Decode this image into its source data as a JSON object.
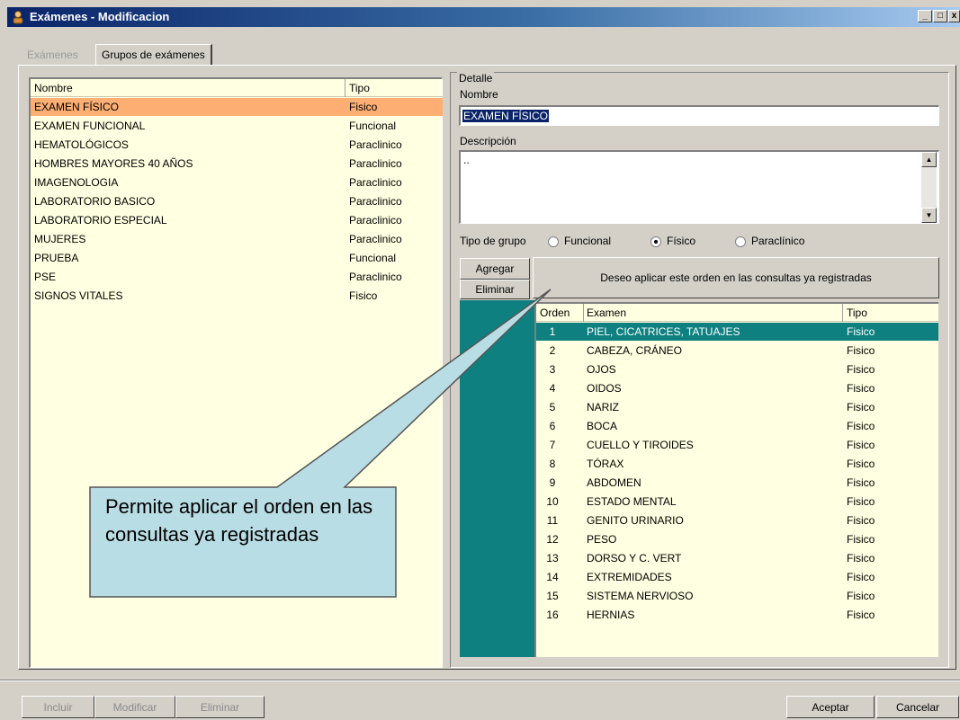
{
  "window": {
    "title": "Exámenes - Modificacion",
    "app_icon": "user-icon",
    "controls": [
      "_",
      "□",
      "x"
    ]
  },
  "tabs": [
    {
      "label": "Exámenes",
      "active": false
    },
    {
      "label": "Grupos de exámenes",
      "active": true
    }
  ],
  "groups_list": {
    "headers": {
      "name": "Nombre",
      "type": "Tipo"
    },
    "rows": [
      {
        "name": "EXAMEN FÍSICO",
        "type": "Fisico",
        "selected": true
      },
      {
        "name": "EXAMEN FUNCIONAL",
        "type": "Funcional"
      },
      {
        "name": "HEMATOLÓGICOS",
        "type": "Paraclinico"
      },
      {
        "name": "HOMBRES MAYORES 40 AÑOS",
        "type": "Paraclinico"
      },
      {
        "name": "IMAGENOLOGIA",
        "type": "Paraclinico"
      },
      {
        "name": "LABORATORIO BASICO",
        "type": "Paraclinico"
      },
      {
        "name": "LABORATORIO ESPECIAL",
        "type": "Paraclinico"
      },
      {
        "name": "MUJERES",
        "type": "Paraclinico"
      },
      {
        "name": "PRUEBA",
        "type": "Funcional"
      },
      {
        "name": "PSE",
        "type": "Paraclinico"
      },
      {
        "name": "SIGNOS VITALES",
        "type": "Fisico"
      }
    ]
  },
  "detail": {
    "legend": "Detalle",
    "name_label": "Nombre",
    "name_value": "EXAMEN FÍSICO",
    "description_label": "Descripción",
    "description_value": "..",
    "group_type_label": "Tipo de grupo",
    "group_type_options": [
      {
        "label": "Funcional",
        "checked": false
      },
      {
        "label": "Físico",
        "checked": true
      },
      {
        "label": "Paraclínico",
        "checked": false
      }
    ],
    "add_button": "Agregar",
    "remove_button": "Eliminar",
    "apply_order_button": "Deseo aplicar este orden en las consultas ya registradas",
    "exams_grid": {
      "headers": {
        "order": "Orden",
        "exam": "Examen",
        "type": "Tipo"
      },
      "rows": [
        {
          "order": "1",
          "exam": "PIEL, CICATRICES, TATUAJES",
          "type": "Fisico",
          "selected": true
        },
        {
          "order": "2",
          "exam": "CABEZA, CRÁNEO",
          "type": "Fisico"
        },
        {
          "order": "3",
          "exam": "OJOS",
          "type": "Fisico"
        },
        {
          "order": "4",
          "exam": "OIDOS",
          "type": "Fisico"
        },
        {
          "order": "5",
          "exam": "NARIZ",
          "type": "Fisico"
        },
        {
          "order": "6",
          "exam": "BOCA",
          "type": "Fisico"
        },
        {
          "order": "7",
          "exam": "CUELLO Y TIROIDES",
          "type": "Fisico"
        },
        {
          "order": "8",
          "exam": "TÓRAX",
          "type": "Fisico"
        },
        {
          "order": "9",
          "exam": "ABDOMEN",
          "type": "Fisico"
        },
        {
          "order": "10",
          "exam": "ESTADO MENTAL",
          "type": "Fisico"
        },
        {
          "order": "11",
          "exam": "GENITO URINARIO",
          "type": "Fisico"
        },
        {
          "order": "12",
          "exam": "PESO",
          "type": "Fisico"
        },
        {
          "order": "13",
          "exam": "DORSO Y C. VERT",
          "type": "Fisico"
        },
        {
          "order": "14",
          "exam": "EXTREMIDADES",
          "type": "Fisico"
        },
        {
          "order": "15",
          "exam": "SISTEMA NERVIOSO",
          "type": "Fisico"
        },
        {
          "order": "16",
          "exam": "HERNIAS",
          "type": "Fisico"
        }
      ]
    }
  },
  "callout": {
    "text": "Permite aplicar el orden en las consultas ya registradas"
  },
  "footer": {
    "include": "Incluir",
    "modify": "Modificar",
    "delete": "Eliminar",
    "accept": "Aceptar",
    "cancel": "Cancelar"
  },
  "colors": {
    "selected_group_row": "#fcae73",
    "selected_exam_row": "#0f8080",
    "list_background": "#ffffe1",
    "callout_fill": "#b9dde4",
    "teal_panel": "#0f8080"
  }
}
